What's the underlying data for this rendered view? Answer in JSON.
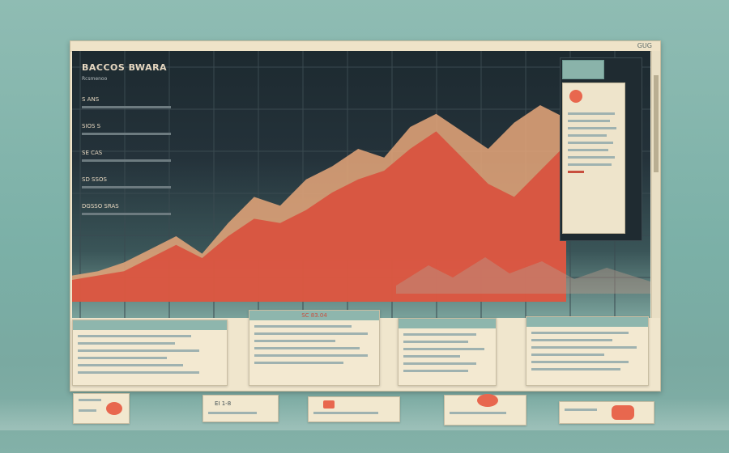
{
  "window": {
    "label": "GUG"
  },
  "header": {
    "title": "BACCOS BWARA",
    "subtitle": "Rcsmenoo"
  },
  "sidebar_left": {
    "labels": [
      "S ANS",
      "SIOS S",
      "SE CAS",
      "SD SSOS"
    ],
    "section": "DGSSO SRAS"
  },
  "colors": {
    "accent": "#e8674e",
    "accent_dark": "#c84f3e",
    "panel_bg": "#f0e6cd",
    "screen_bg": "#1d2a30",
    "background": "#7bb0a7"
  },
  "bottom_cards": [
    {
      "heading": "",
      "rows": 6
    },
    {
      "heading": "SC 83.04",
      "rows": 6
    },
    {
      "heading": "",
      "rows": 6
    },
    {
      "heading": "",
      "rows": 6
    }
  ],
  "dock_badges": [
    {
      "label": ""
    },
    {
      "label": "EI 1-8"
    },
    {
      "label": ""
    },
    {
      "label": ""
    },
    {
      "label": ""
    }
  ],
  "chart_data": {
    "type": "area",
    "title": "",
    "series": [
      {
        "values": [
          12,
          14,
          18,
          24,
          30,
          22,
          36,
          48,
          44,
          56,
          62,
          70,
          66,
          80,
          86,
          78,
          70,
          82,
          90,
          84
        ]
      },
      {
        "values": [
          10,
          12,
          14,
          20,
          26,
          20,
          30,
          38,
          36,
          42,
          50,
          56,
          60,
          70,
          78,
          66,
          54,
          48,
          60,
          72
        ]
      }
    ],
    "x": [
      1,
      2,
      3,
      4,
      5,
      6,
      7,
      8,
      9,
      10,
      11,
      12,
      13,
      14,
      15,
      16,
      17,
      18,
      19,
      20
    ],
    "ylim": [
      0,
      100
    ],
    "grid": true
  }
}
